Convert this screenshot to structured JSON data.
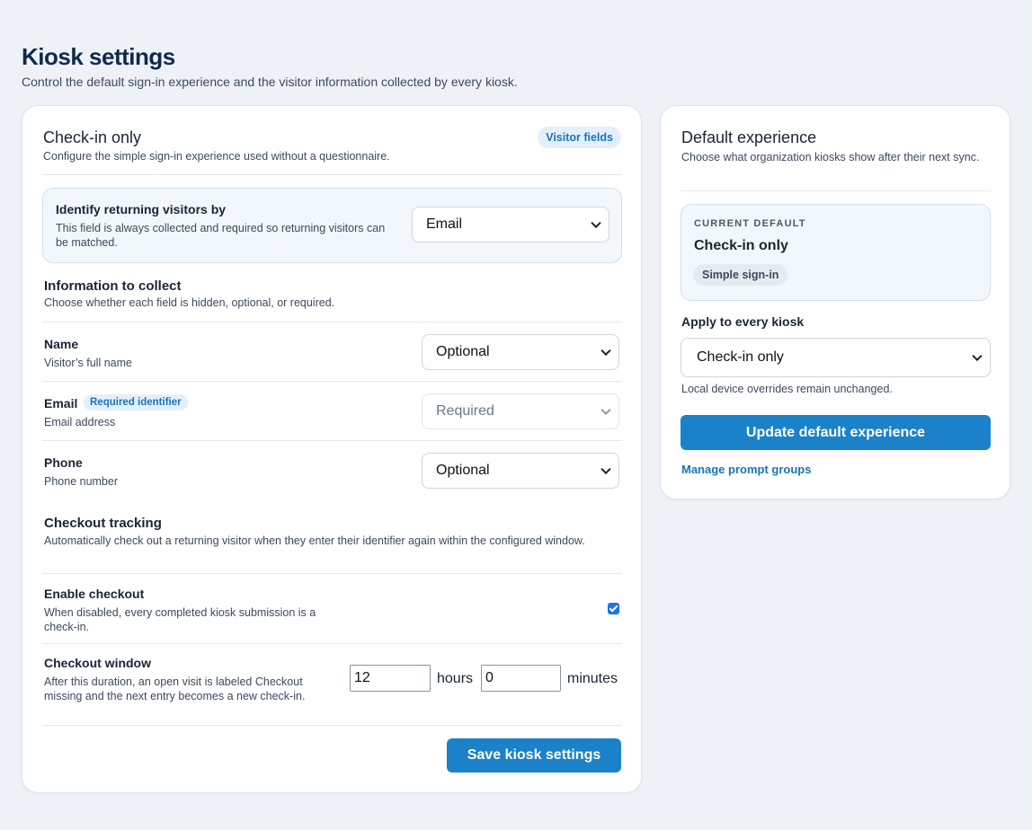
{
  "page": {
    "title": "Kiosk settings",
    "subtitle": "Control the default sign-in experience and the visitor information collected by every kiosk."
  },
  "checkin": {
    "title": "Check-in only",
    "subtitle": "Configure the simple sign-in experience used without a questionnaire.",
    "badge": "Visitor fields",
    "identify": {
      "label": "Identify returning visitors by",
      "help": "This field is always collected and required so returning visitors can be matched.",
      "value": "Email"
    },
    "collect": {
      "title": "Information to collect",
      "subtitle": "Choose whether each field is hidden, optional, or required."
    },
    "fields": [
      {
        "label": "Name",
        "help": "Visitor’s full name",
        "value": "Optional",
        "badge": "",
        "disabled": false
      },
      {
        "label": "Email",
        "help": "Email address",
        "value": "Required",
        "badge": "Required identifier",
        "disabled": true
      },
      {
        "label": "Phone",
        "help": "Phone number",
        "value": "Optional",
        "badge": "",
        "disabled": false
      }
    ],
    "checkout": {
      "title": "Checkout tracking",
      "subtitle": "Automatically check out a returning visitor when they enter their identifier again within the configured window.",
      "enable_label": "Enable checkout",
      "enable_help": "When disabled, every completed kiosk submission is a check-in.",
      "enabled": true,
      "window_label": "Checkout window",
      "window_help": "After this duration, an open visit is labeled Checkout missing and the next entry becomes a new check-in.",
      "hours": "12",
      "hours_unit": "hours",
      "minutes": "0",
      "minutes_unit": "minutes"
    },
    "save_label": "Save kiosk settings"
  },
  "default_experience": {
    "title": "Default experience",
    "subtitle": "Choose what organization kiosks show after their next sync.",
    "current_eyebrow": "CURRENT DEFAULT",
    "current_value": "Check-in only",
    "current_badge": "Simple sign-in",
    "apply_label": "Apply to every kiosk",
    "apply_value": "Check-in only",
    "note": "Local device overrides remain unchanged.",
    "update_label": "Update default experience",
    "manage_link": "Manage prompt groups"
  },
  "colors": {
    "primary": "#1b82c9",
    "background": "#eef2f7",
    "accent_pill": "#e3f0fb"
  }
}
